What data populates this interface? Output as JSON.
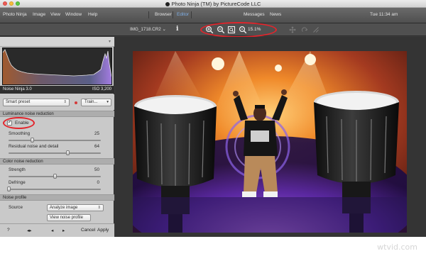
{
  "window": {
    "title": "Photo Ninja (TM) by PictureCode LLC"
  },
  "menu": {
    "items": [
      "Photo Ninja",
      "Image",
      "View",
      "Window",
      "Help"
    ],
    "tabs": [
      "Browser",
      "Editor"
    ],
    "active_tab": "Editor",
    "right_items": [
      "Messages",
      "News"
    ],
    "clock": "Tue 11:34 am"
  },
  "toolbar": {
    "filename": "IMG_1718.CR2",
    "info_glyph": "i",
    "zoom_percent": "15.1%",
    "icons": [
      "zoom-in-icon",
      "zoom-out-icon",
      "fit-to-window-icon",
      "zoom-actual-icon",
      "move-icon",
      "rotate-icon",
      "straighten-icon"
    ]
  },
  "histogram": {
    "caption": "Noise Ninja 3.0",
    "iso": "ISO 3,200"
  },
  "preset": {
    "value": "Smart preset",
    "train_label": "Train..."
  },
  "luminance": {
    "header": "Luminance noise reduction",
    "enable_label": "Enable",
    "enable_checked": true,
    "sliders": [
      {
        "label": "Smoothing",
        "value": "25",
        "fraction": 0.25
      },
      {
        "label": "Residual noise and detail",
        "value": "64",
        "fraction": 0.64
      }
    ]
  },
  "color": {
    "header": "Color noise reduction",
    "sliders": [
      {
        "label": "Strength",
        "value": "50",
        "fraction": 0.5
      },
      {
        "label": "Defringe",
        "value": "0",
        "fraction": 0.0
      }
    ]
  },
  "profile": {
    "header": "Noise profile",
    "source_label": "Source",
    "source_value": "Analyze image",
    "view_button": "View noise profile"
  },
  "footer": {
    "help": "?",
    "cancel": "Cancel",
    "apply": "Apply"
  },
  "highlight_color": "#e3242b",
  "watermark": "wtvid.com"
}
